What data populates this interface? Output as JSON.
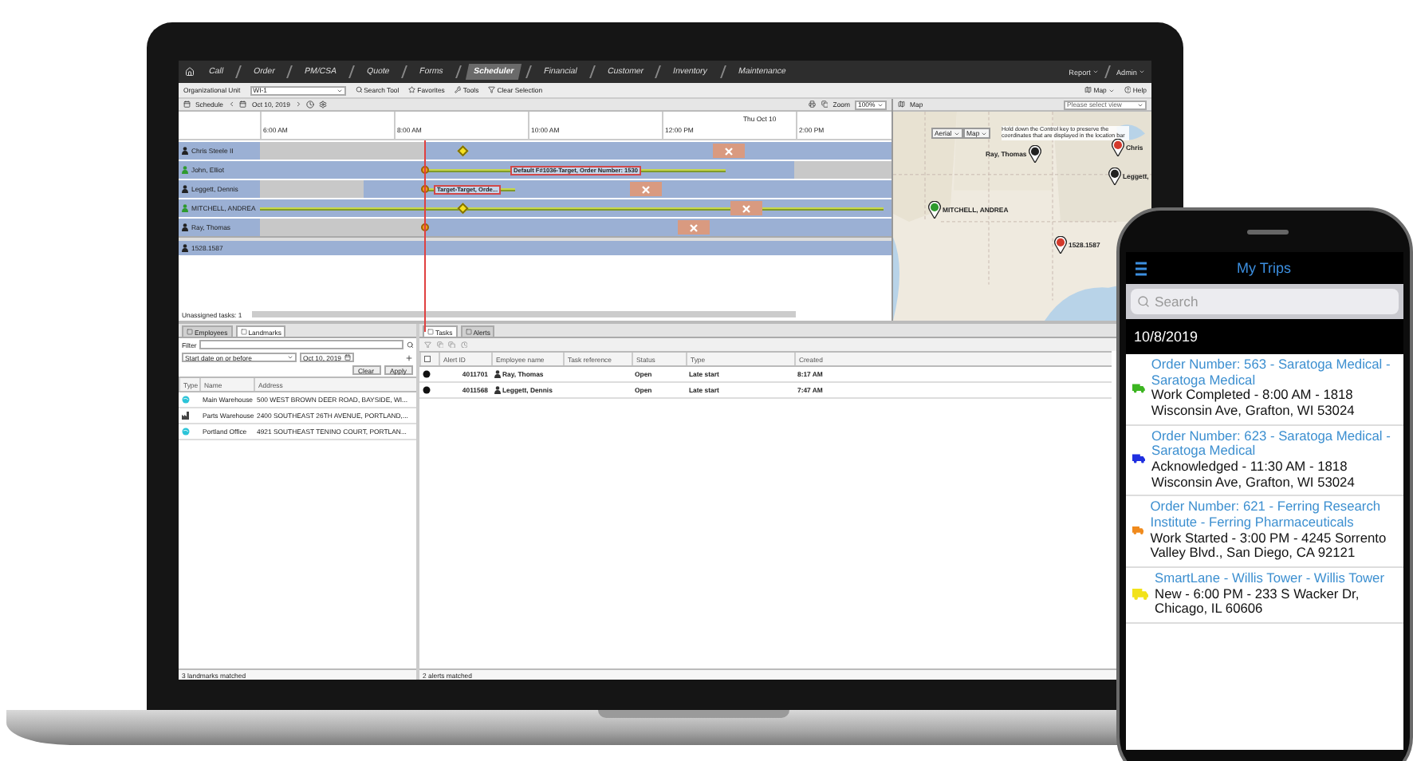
{
  "nav": {
    "tabs": [
      {
        "label": "Call",
        "selected": false
      },
      {
        "label": "Order",
        "selected": false
      },
      {
        "label": "PM/CSA",
        "selected": false
      },
      {
        "label": "Quote",
        "selected": false
      },
      {
        "label": "Forms",
        "selected": false
      },
      {
        "label": "Scheduler",
        "selected": true
      },
      {
        "label": "Financial",
        "selected": false
      },
      {
        "label": "Customer",
        "selected": false
      },
      {
        "label": "Inventory",
        "selected": false
      },
      {
        "label": "Maintenance",
        "selected": false
      }
    ],
    "menus": [
      "Report",
      "Admin"
    ]
  },
  "toolbar": {
    "org_label": "Organizational Unit",
    "org_value": "WI-1",
    "tools": [
      "Search Tool",
      "Favorites",
      "Tools",
      "Clear Selection"
    ],
    "map": "Map",
    "help": "Help"
  },
  "scheduler": {
    "title": "Schedule",
    "date": "Oct 10, 2019",
    "zoom_label": "Zoom",
    "zoom_value": "100%",
    "day_label": "Thu Oct 10",
    "times": [
      "6:00 AM",
      "8:00 AM",
      "10:00 AM",
      "12:00 PM",
      "2:00 PM"
    ],
    "employees": [
      {
        "name": "Chris Steele II",
        "color": "#222222"
      },
      {
        "name": "John, Elliot",
        "color": "#2e9a2e",
        "bar_label": "Default F#1036-Target, Order Number: 1530"
      },
      {
        "name": "Leggett, Dennis",
        "color": "#222222",
        "bar_label": "Target-Target, Orde..."
      },
      {
        "name": "MITCHELL, ANDREA",
        "color": "#2e9a2e"
      },
      {
        "name": "Ray, Thomas",
        "color": "#222222"
      }
    ],
    "vehicles": [
      "1528.1587"
    ],
    "unassigned": "Unassigned tasks: 1"
  },
  "map": {
    "title": "Map",
    "view_placeholder": "Please select view",
    "modes": [
      "Aerial",
      "Map"
    ],
    "hint": "Hold down the Control key to preserve the coordinates that are displayed in the location bar",
    "markers": [
      {
        "label": "Ray, Thomas",
        "color": "#222222"
      },
      {
        "label": "Chris",
        "color": "#d33a2c"
      },
      {
        "label": "Leggett,",
        "color": "#222222"
      },
      {
        "label": "MITCHELL, ANDREA",
        "color": "#2e9a2e"
      },
      {
        "label": "1528.1587",
        "color": "#d33a2c"
      }
    ]
  },
  "landmarks_panel": {
    "tabs": [
      {
        "label": "Employees",
        "selected": false
      },
      {
        "label": "Landmarks",
        "selected": true
      }
    ],
    "filter_label": "Filter",
    "date_filter": "Start date on or before",
    "date": "Oct 10, 2019",
    "buttons": [
      "Clear",
      "Apply"
    ],
    "columns": [
      "Type",
      "Name",
      "Address"
    ],
    "rows": [
      {
        "kind": "site",
        "name": "Main Warehouse",
        "address": "500 WEST BROWN DEER ROAD, BAYSIDE, WI..."
      },
      {
        "kind": "warehouse",
        "name": "Parts Warehouse",
        "address": "2400 SOUTHEAST 26TH AVENUE, PORTLAND,..."
      },
      {
        "kind": "site",
        "name": "Portland Office",
        "address": "4921 SOUTHEAST TENINO COURT, PORTLAN..."
      }
    ],
    "footer": "3 landmarks matched"
  },
  "alerts_panel": {
    "select_all_checked": false,
    "tabs": [
      {
        "label": "Tasks",
        "selected": true
      },
      {
        "label": "Alerts",
        "selected": false
      }
    ],
    "columns": [
      "Alert ID",
      "Employee name",
      "Task reference",
      "Status",
      "Type",
      "Created"
    ],
    "rows": [
      {
        "alert_id": "4011701",
        "employee": "Ray, Thomas",
        "status": "Open",
        "type": "Late start",
        "created": "8:17 AM"
      },
      {
        "alert_id": "4011568",
        "employee": "Leggett, Dennis",
        "status": "Open",
        "type": "Late start",
        "created": "7:47 AM"
      }
    ],
    "footer": "2 alerts matched"
  },
  "phone": {
    "title": "My Trips",
    "search_placeholder": "Search",
    "date": "10/8/2019",
    "trips": [
      {
        "title": "Order Number: 563 - Saratoga Medical - Saratoga Medical",
        "detail": "Work Completed - 8:00 AM - 1818 Wisconsin Ave, Grafton, WI 53024",
        "color": "#3cb521"
      },
      {
        "title": "Order Number: 623 - Saratoga Medical - Saratoga Medical",
        "detail": "Acknowledged - 11:30 AM - 1818 Wisconsin Ave, Grafton, WI 53024",
        "color": "#1f2fe0"
      },
      {
        "title": "Order Number: 621 - Ferring Research Institute - Ferring Pharmaceuticals",
        "detail": "Work Started - 3:00 PM - 4245 Sorrento Valley Blvd., San Diego, CA 92121",
        "color": "#f08a1c"
      },
      {
        "title": "SmartLane - Willis Tower - Willis Tower",
        "detail": "New - 6:00 PM - 233 S Wacker Dr, Chicago, IL 60606",
        "color": "#f2e21a"
      }
    ]
  }
}
